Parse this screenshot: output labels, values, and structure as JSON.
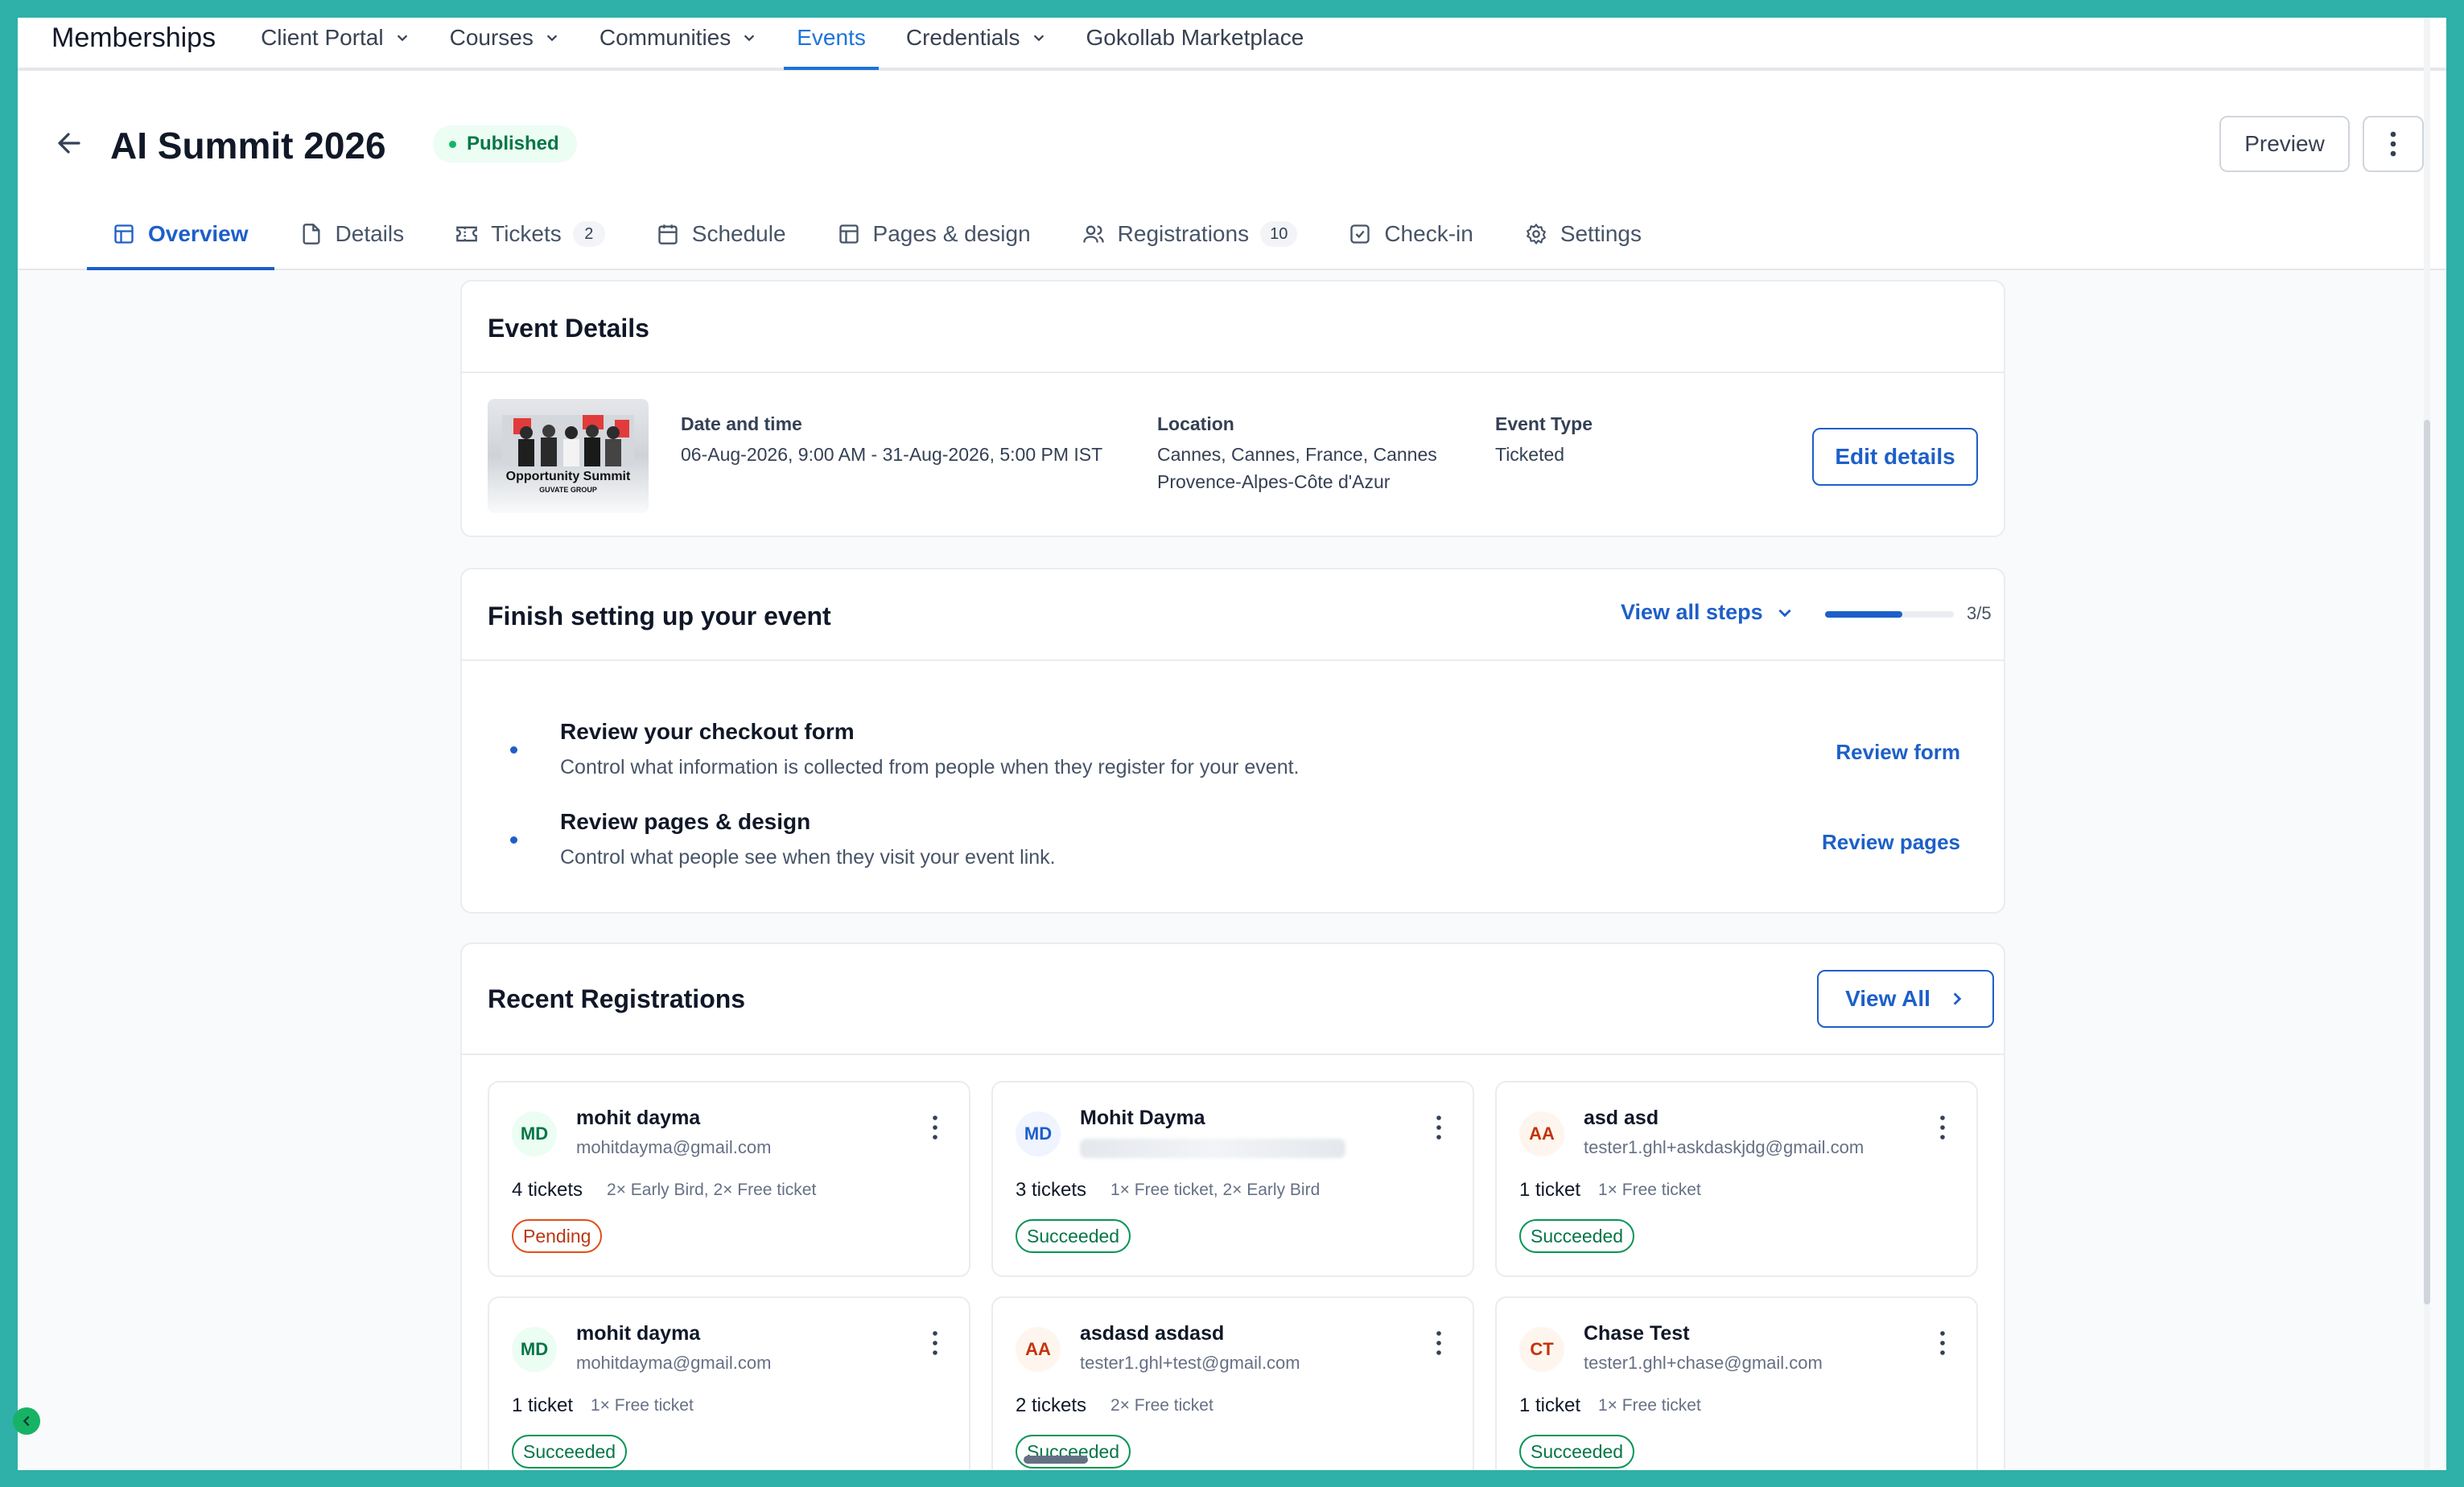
{
  "topnav": {
    "brand": "Memberships",
    "items": [
      {
        "label": "Client Portal",
        "dropdown": true
      },
      {
        "label": "Courses",
        "dropdown": true
      },
      {
        "label": "Communities",
        "dropdown": true
      },
      {
        "label": "Events",
        "dropdown": false,
        "active": true
      },
      {
        "label": "Credentials",
        "dropdown": true
      },
      {
        "label": "Gokollab Marketplace",
        "dropdown": false
      }
    ]
  },
  "header": {
    "title": "AI Summit 2026",
    "status": "Published",
    "preview_label": "Preview"
  },
  "tabs": [
    {
      "label": "Overview",
      "icon": "layout-icon",
      "active": true
    },
    {
      "label": "Details",
      "icon": "file-icon"
    },
    {
      "label": "Tickets",
      "icon": "ticket-icon",
      "count": "2"
    },
    {
      "label": "Schedule",
      "icon": "calendar-icon"
    },
    {
      "label": "Pages & design",
      "icon": "layout-icon"
    },
    {
      "label": "Registrations",
      "icon": "users-icon",
      "count": "10"
    },
    {
      "label": "Check-in",
      "icon": "check-square-icon"
    },
    {
      "label": "Settings",
      "icon": "gear-icon"
    }
  ],
  "event_details": {
    "title": "Event Details",
    "thumb_title": "Opportunity Summit",
    "thumb_subtitle": "GUVATE GROUP",
    "date_label": "Date and time",
    "date_value": "06-Aug-2026, 9:00 AM - 31-Aug-2026, 5:00 PM IST",
    "location_label": "Location",
    "location_value": "Cannes, Cannes, France, Cannes Provence-Alpes-Côte d'Azur",
    "type_label": "Event Type",
    "type_value": "Ticketed",
    "edit_label": "Edit details"
  },
  "setup": {
    "title": "Finish setting up your event",
    "view_steps_label": "View all steps",
    "progress_text": "3/5",
    "progress_fraction": 0.6,
    "steps": [
      {
        "title": "Review your checkout form",
        "desc": "Control what information is collected from people when they register for your event.",
        "link": "Review form"
      },
      {
        "title": "Review pages & design",
        "desc": "Control what people see when they visit your event link.",
        "link": "Review pages"
      }
    ]
  },
  "registrations": {
    "title": "Recent Registrations",
    "view_all_label": "View All",
    "items": [
      {
        "initials": "MD",
        "name": "mohit dayma",
        "email": "mohitdayma@gmail.com",
        "tickets": "4 tickets",
        "types": "2× Early Bird, 2× Free ticket",
        "status": "Pending"
      },
      {
        "initials": "MD",
        "name": "Mohit Dayma",
        "email": "",
        "tickets": "3 tickets",
        "types": "1× Free ticket, 2× Early Bird",
        "status": "Succeeded"
      },
      {
        "initials": "AA",
        "name": "asd asd",
        "email": "tester1.ghl+askdaskjdg@gmail.com",
        "tickets": "1 ticket",
        "types": "1× Free ticket",
        "status": "Succeeded"
      },
      {
        "initials": "MD",
        "name": "mohit dayma",
        "email": "mohitdayma@gmail.com",
        "tickets": "1 ticket",
        "types": "1× Free ticket",
        "status": "Succeeded"
      },
      {
        "initials": "AA",
        "name": "asdasd asdasd",
        "email": "tester1.ghl+test@gmail.com",
        "tickets": "2 tickets",
        "types": "2× Free ticket",
        "status": "Succeeded"
      },
      {
        "initials": "CT",
        "name": "Chase Test",
        "email": "tester1.ghl+chase@gmail.com",
        "tickets": "1 ticket",
        "types": "1× Free ticket",
        "status": "Succeeded"
      }
    ]
  }
}
